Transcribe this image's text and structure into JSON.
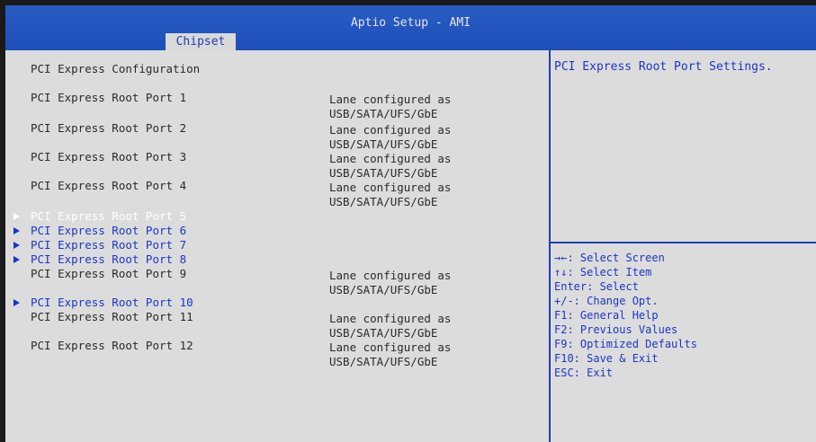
{
  "app": {
    "title": "Aptio Setup - AMI",
    "active_tab": "Chipset"
  },
  "main": {
    "section_title": "PCI Express Configuration",
    "items": [
      {
        "label": "PCI Express Root Port 1",
        "value": "Lane configured as\nUSB/SATA/UFS/GbE",
        "submenu": false,
        "selected": false
      },
      {
        "label": "PCI Express Root Port 2",
        "value": "Lane configured as\nUSB/SATA/UFS/GbE",
        "submenu": false,
        "selected": false
      },
      {
        "label": "PCI Express Root Port 3",
        "value": "Lane configured as\nUSB/SATA/UFS/GbE",
        "submenu": false,
        "selected": false
      },
      {
        "label": "PCI Express Root Port 4",
        "value": "Lane configured as\nUSB/SATA/UFS/GbE",
        "submenu": false,
        "selected": false
      },
      {
        "label": "PCI Express Root Port 5",
        "submenu": true,
        "selected": true
      },
      {
        "label": "PCI Express Root Port 6",
        "submenu": true,
        "selected": false
      },
      {
        "label": "PCI Express Root Port 7",
        "submenu": true,
        "selected": false
      },
      {
        "label": "PCI Express Root Port 8",
        "submenu": true,
        "selected": false
      },
      {
        "label": "PCI Express Root Port 9",
        "value": "Lane configured as\nUSB/SATA/UFS/GbE",
        "submenu": false,
        "selected": false
      },
      {
        "label": "PCI Express Root Port 10",
        "submenu": true,
        "selected": false
      },
      {
        "label": "PCI Express Root Port 11",
        "value": "Lane configured as\nUSB/SATA/UFS/GbE",
        "submenu": false,
        "selected": false
      },
      {
        "label": "PCI Express Root Port 12",
        "value": "Lane configured as\nUSB/SATA/UFS/GbE",
        "submenu": false,
        "selected": false
      }
    ]
  },
  "help": {
    "description": "PCI Express Root Port Settings.",
    "keys": [
      "→←: Select Screen",
      "↑↓: Select Item",
      "Enter: Select",
      "+/-: Change Opt.",
      "F1: General Help",
      "F2: Previous Values",
      "F9: Optimized Defaults",
      "F10: Save & Exit",
      "ESC: Exit"
    ]
  },
  "colors": {
    "header_blue": "#2a5cc5",
    "panel_bg": "#dcdcdc",
    "accent_blue": "#1a36c8",
    "highlight_white": "#ffffff"
  }
}
